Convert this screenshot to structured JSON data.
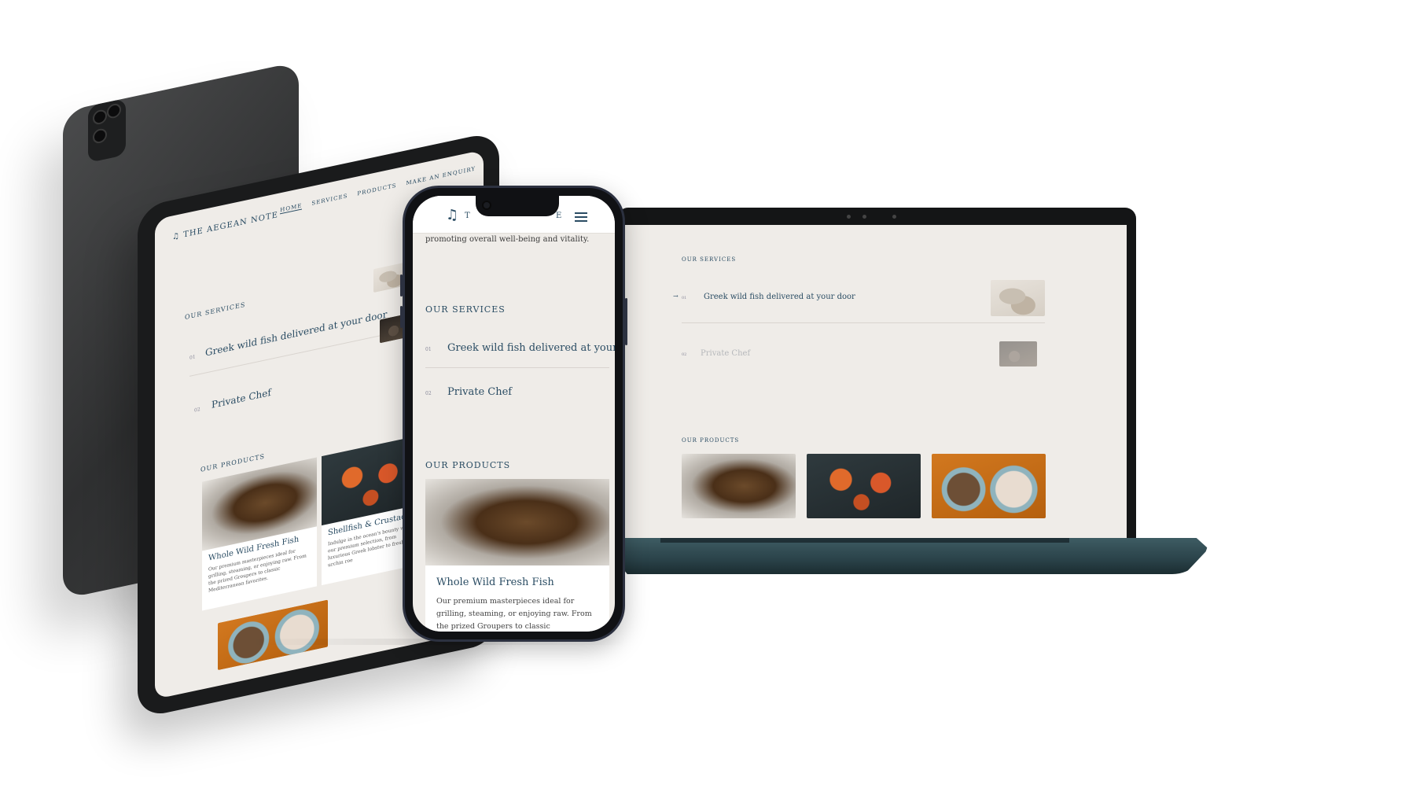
{
  "brand": {
    "name": "THE AEGEAN NOTE",
    "logo_icon": "music-note-icon",
    "logo_glyph": "♫",
    "phone_logo_partial": "T",
    "phone_logo_tail": "E"
  },
  "nav": {
    "home": "HOME",
    "services": "SERVICES",
    "products": "PRODUCTS",
    "enquiry": "MAKE AN ENQUIRY"
  },
  "intro_text": "promoting overall well-being and vitality.",
  "services": {
    "label": "OUR SERVICES",
    "items": [
      {
        "num": "01",
        "title": "Greek wild fish delivered at your door"
      },
      {
        "num": "02",
        "title": "Private Chef"
      }
    ]
  },
  "products": {
    "label": "OUR PRODUCTS",
    "items": [
      {
        "title": "Whole Wild Fresh Fish",
        "body": "Our premium masterpieces ideal for grilling, steaming, or enjoying raw. From the prized Groupers to classic Mediterranean favorites."
      },
      {
        "title": "Shellfish & Crustaceans",
        "body": "Indulge in the ocean's bounty with our premium selection, from luxurious Greek lobster to fresh sea urchin roe"
      }
    ]
  },
  "colors": {
    "accent": "#2a4c63",
    "page_bg": "#efece8",
    "laptop_base": "#2a4249"
  }
}
